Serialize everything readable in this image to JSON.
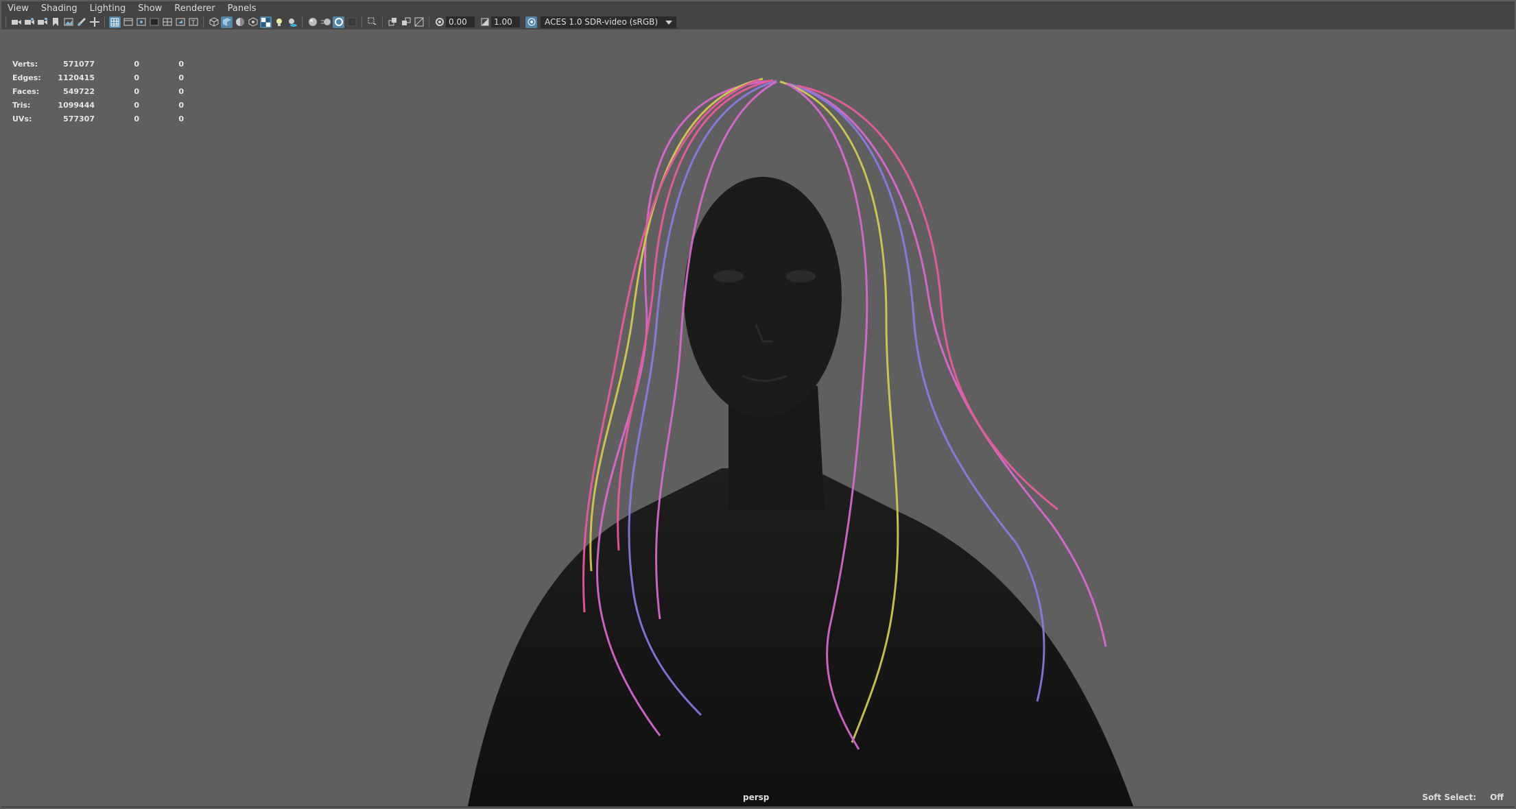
{
  "menubar": {
    "items": [
      "View",
      "Shading",
      "Lighting",
      "Show",
      "Renderer",
      "Panels"
    ]
  },
  "toolbar": {
    "exposure_value": "0.00",
    "gamma_value": "1.00",
    "color_space": "ACES 1.0 SDR-video (sRGB)",
    "icons": [
      "camera-icon",
      "camera-lock-icon",
      "camera-attr-icon",
      "bookmark-icon",
      "image-plane-icon",
      "grease-pencil-icon",
      "2d-pan-icon",
      "wireframe-icon",
      "grid-icon",
      "film-gate-icon",
      "resolution-gate-icon",
      "gate-mask-icon",
      "field-chart-icon",
      "safe-action-icon",
      "safe-title-icon",
      "wireframe-shaded-icon",
      "smooth-shade-icon",
      "default-material-icon",
      "xray-icon",
      "textured-icon",
      "lights-icon",
      "shadows-icon",
      "ambient-occlusion-icon",
      "motion-blur-icon",
      "anti-alias-icon",
      "isolate-select-icon",
      "xray-joints-icon",
      "xray-active-icon",
      "exposure-icon",
      "gamma-icon",
      "color-management-icon"
    ]
  },
  "hud": {
    "rows": [
      {
        "label": "Verts:",
        "v1": "571077",
        "v2": "0",
        "v3": "0"
      },
      {
        "label": "Edges:",
        "v1": "1120415",
        "v2": "0",
        "v3": "0"
      },
      {
        "label": "Faces:",
        "v1": "549722",
        "v2": "0",
        "v3": "0"
      },
      {
        "label": "Tris:",
        "v1": "1099444",
        "v2": "0",
        "v3": "0"
      },
      {
        "label": "UVs:",
        "v1": "577307",
        "v2": "0",
        "v3": "0"
      }
    ]
  },
  "viewport": {
    "camera_label": "persp",
    "soft_select_label": "Soft Select:",
    "soft_select_value": "Off",
    "background_color": "#5f5f5f",
    "accent_color": "#5285a6"
  }
}
